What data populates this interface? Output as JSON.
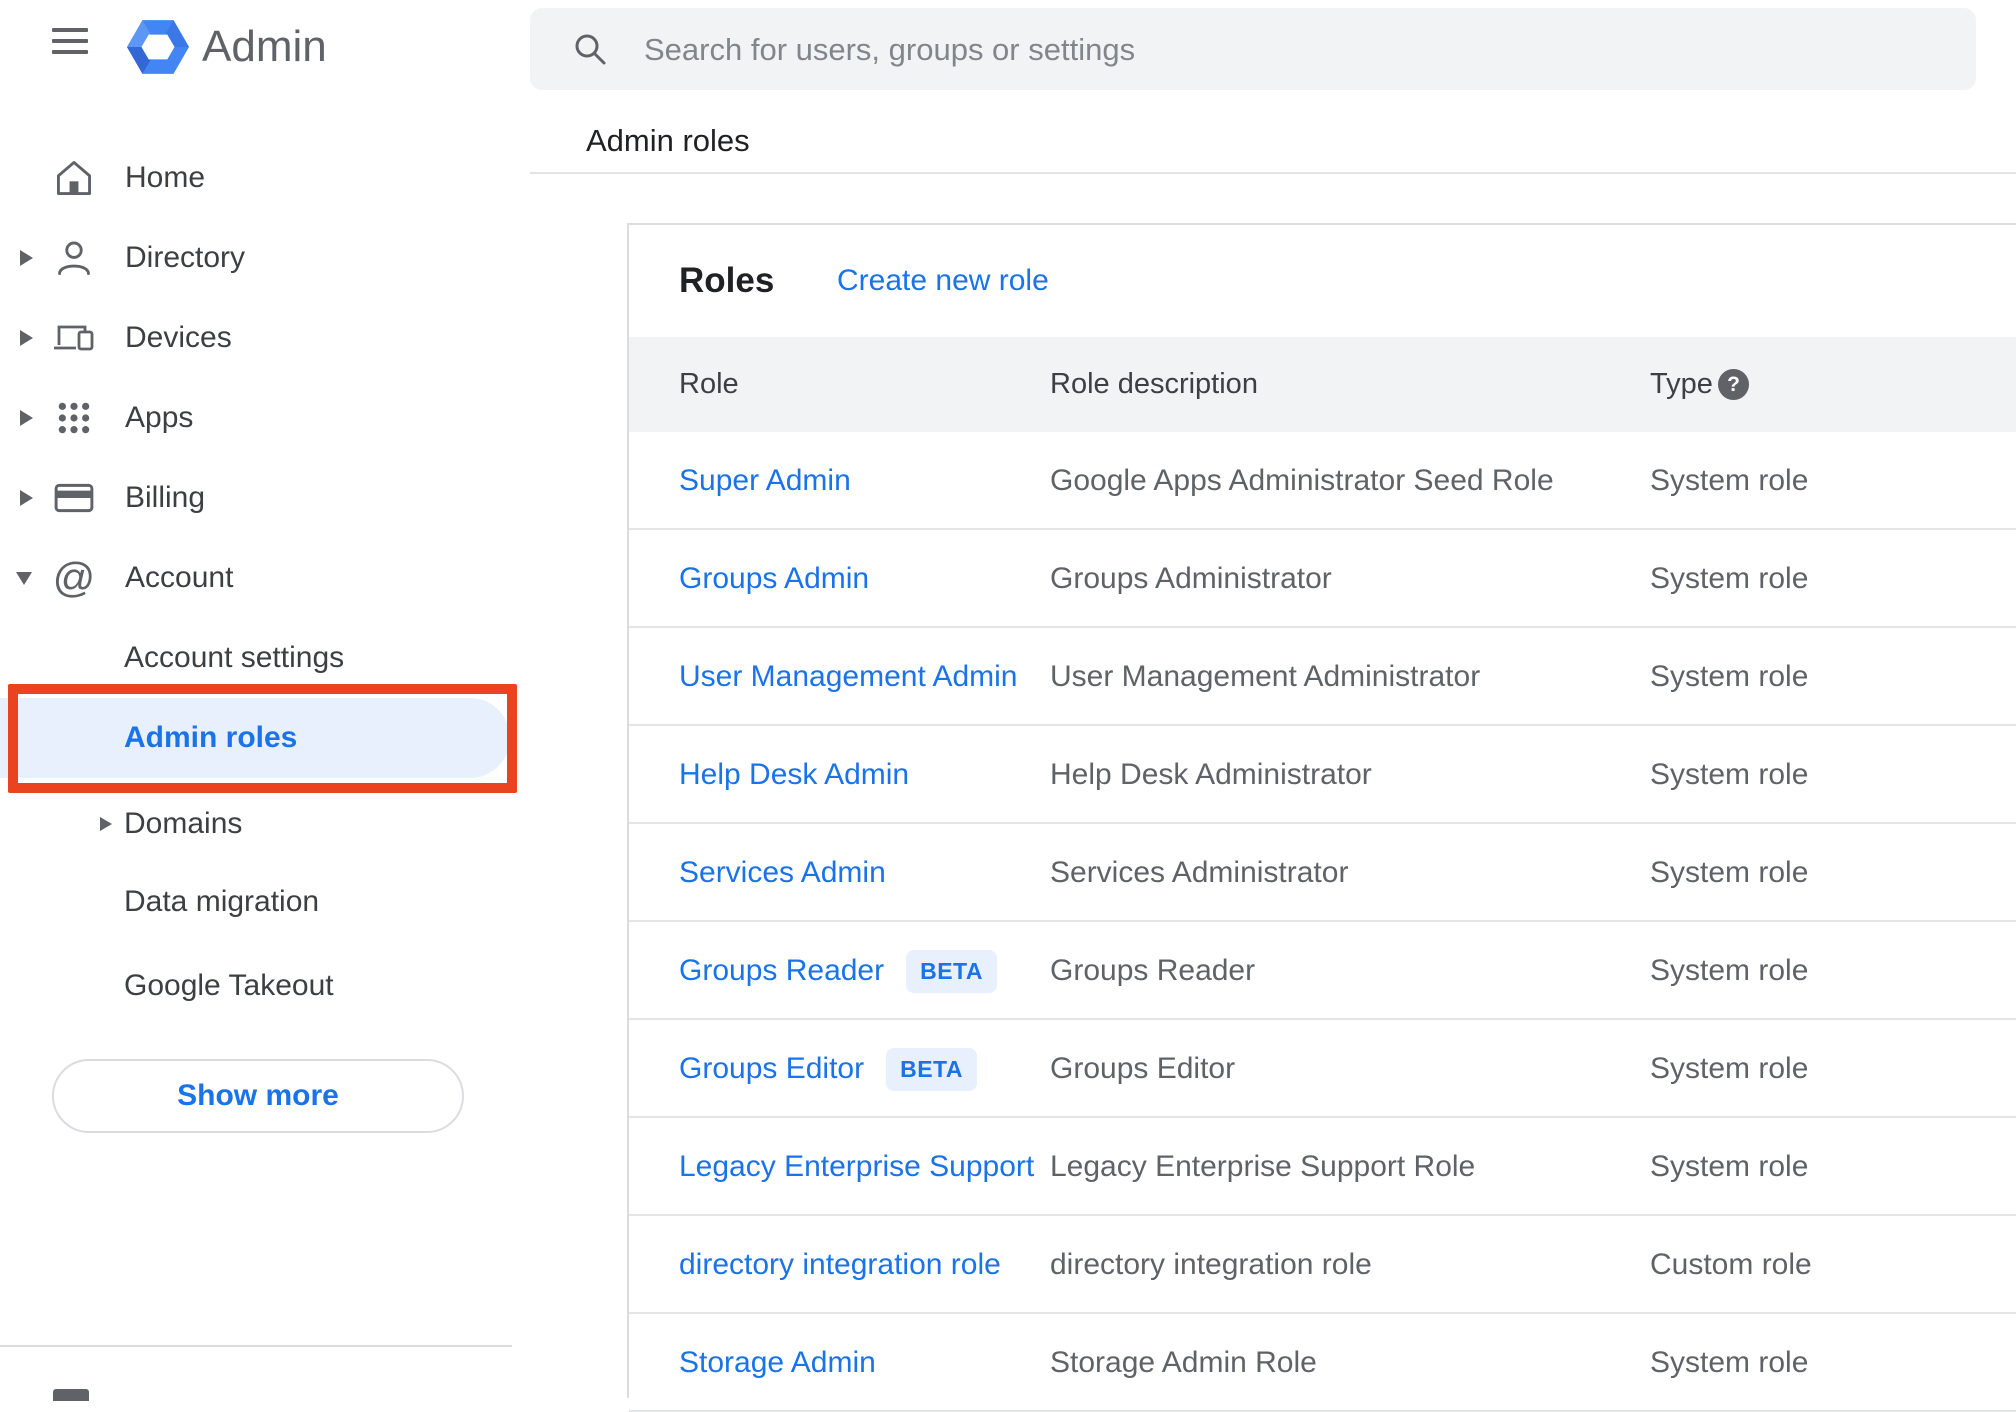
{
  "app": {
    "product_name": "Admin"
  },
  "search": {
    "placeholder": "Search for users, groups or settings"
  },
  "breadcrumb": {
    "label": "Admin roles"
  },
  "sidebar": {
    "items": [
      {
        "label": "Home"
      },
      {
        "label": "Directory"
      },
      {
        "label": "Devices"
      },
      {
        "label": "Apps"
      },
      {
        "label": "Billing"
      },
      {
        "label": "Account"
      }
    ],
    "account_children": [
      {
        "label": "Account settings"
      },
      {
        "label": "Admin roles",
        "active": true
      },
      {
        "label": "Domains"
      },
      {
        "label": "Data migration"
      },
      {
        "label": "Google Takeout"
      }
    ],
    "show_more_label": "Show more"
  },
  "roles_card": {
    "title": "Roles",
    "create_link_label": "Create new role",
    "help_glyph": "?",
    "columns": {
      "role": "Role",
      "description": "Role description",
      "type": "Type"
    },
    "rows": [
      {
        "role": "Super Admin",
        "description": "Google Apps Administrator Seed Role",
        "type": "System role"
      },
      {
        "role": "Groups Admin",
        "description": "Groups Administrator",
        "type": "System role"
      },
      {
        "role": "User Management Admin",
        "description": "User Management Administrator",
        "type": "System role"
      },
      {
        "role": "Help Desk Admin",
        "description": "Help Desk Administrator",
        "type": "System role"
      },
      {
        "role": "Services Admin",
        "description": "Services Administrator",
        "type": "System role"
      },
      {
        "role": "Groups Reader",
        "beta": "BETA",
        "description": "Groups Reader",
        "type": "System role"
      },
      {
        "role": "Groups Editor",
        "beta": "BETA",
        "description": "Groups Editor",
        "type": "System role"
      },
      {
        "role": "Legacy Enterprise Support",
        "description": "Legacy Enterprise Support Role",
        "type": "System role"
      },
      {
        "role": "directory integration role",
        "description": "directory integration role",
        "type": "Custom role"
      },
      {
        "role": "Storage Admin",
        "description": "Storage Admin Role",
        "type": "System role"
      }
    ]
  },
  "colors": {
    "link_blue": "#1a73e8",
    "active_item_bg": "#e8f0fe",
    "annotation_red": "#e9431f",
    "header_band_bg": "#f1f3f4"
  }
}
